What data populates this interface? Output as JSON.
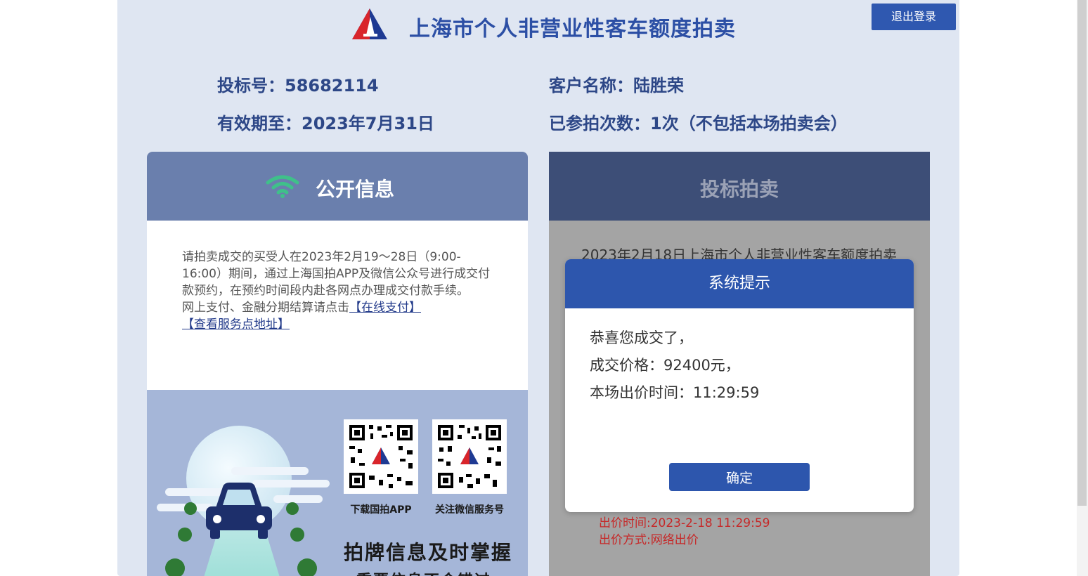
{
  "header": {
    "title": "上海市个人非营业性客车额度拍卖",
    "logout_label": "退出登录"
  },
  "user_info": {
    "bid_number": "投标号：58682114",
    "customer_name": "客户名称：陆胜荣",
    "valid_until": "有效期至：2023年7月31日",
    "participation_count": "已参拍次数：1次（不包括本场拍卖会）"
  },
  "public_info": {
    "title": "公开信息",
    "notice_text": "请拍卖成交的买受人在2023年2月19～28日（9:00-16:00）期间，通过上海国拍APP及微信公众号进行成交付款预约，在预约时间段内赴各网点办理成交付款手续。",
    "payment_prefix": "网上支付、金融分期结算请点击",
    "online_payment_link": "【在线支付】",
    "service_point_link": "【查看服务点地址】",
    "qr_app_label": "下载国拍APP",
    "qr_wechat_label": "关注微信服务号",
    "slogan_line1": "拍牌信息及时掌握",
    "slogan_line2": "重要信息不会错过"
  },
  "bidding": {
    "title": "投标拍卖",
    "auction_name": "2023年2月18日上海市个人非营业性客车额度拍卖",
    "bid_time": "出价时间:2023-2-18 11:29:59",
    "bid_method": "出价方式:网络出价"
  },
  "modal": {
    "title": "系统提示",
    "line1": "恭喜您成交了，",
    "line2": "成交价格：92400元，",
    "line3": "本场出价时间：11:29:59",
    "confirm_label": "确定"
  },
  "colors": {
    "primary": "#2d56ad",
    "panel_bg": "#dfe6f2",
    "public_header": "#6a7fad",
    "bidding_header": "#3d4e77",
    "alert_red": "#c62828",
    "title_blue": "#2c4fa5"
  }
}
